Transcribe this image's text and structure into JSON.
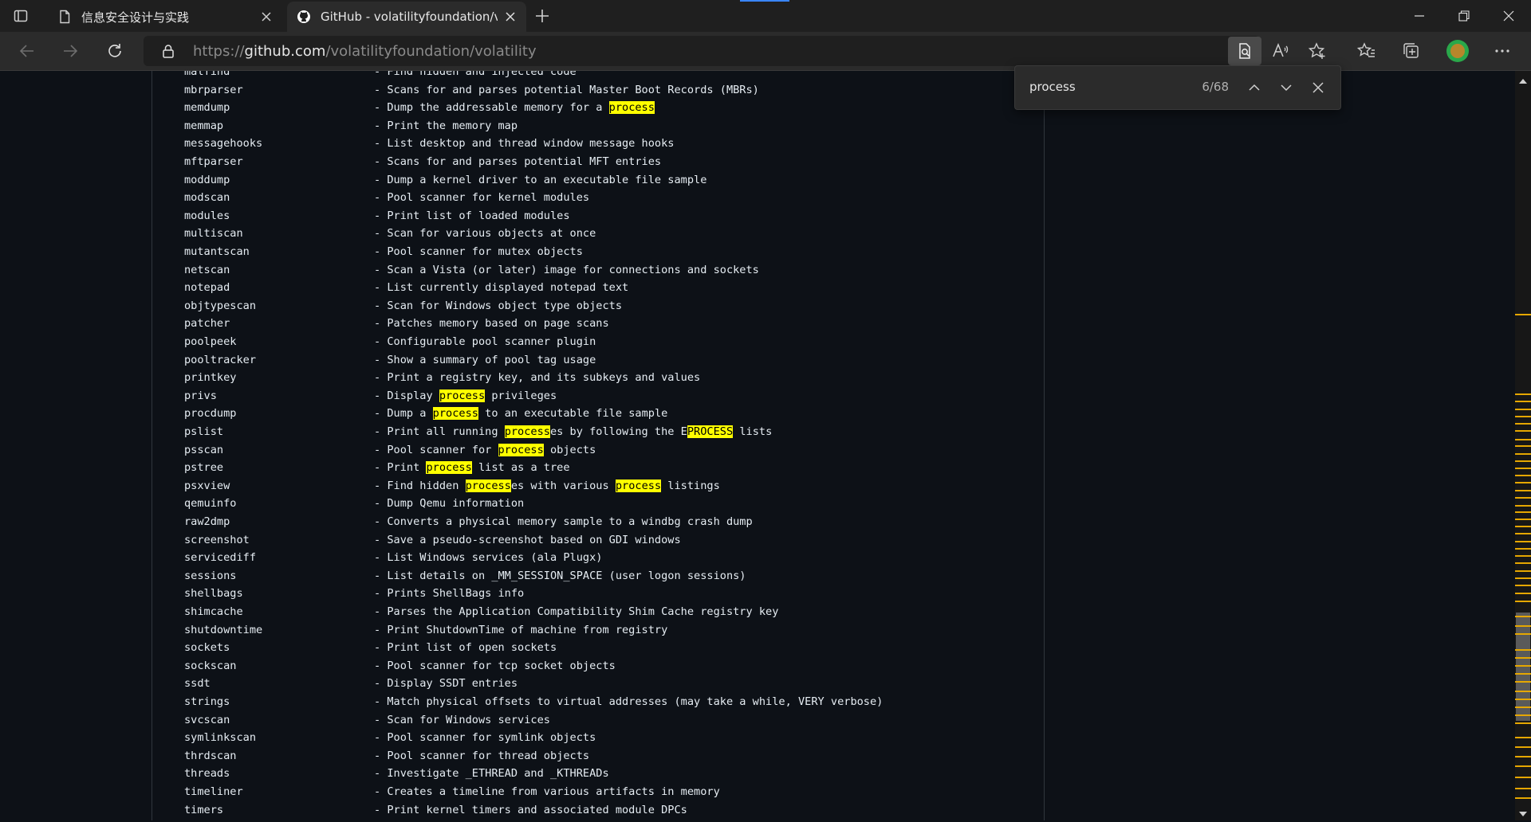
{
  "tabs": [
    {
      "title": "信息安全设计与实践"
    },
    {
      "title": "GitHub - volatilityfoundation/volatility"
    }
  ],
  "address": {
    "scheme": "https://",
    "host": "github.com",
    "path": "/volatilityfoundation/volatility"
  },
  "find": {
    "query": "process",
    "count": "6/68"
  },
  "commands": [
    {
      "name": "malfind",
      "desc": "- Find hidden and injected code"
    },
    {
      "name": "mbrparser",
      "desc": "- Scans for and parses potential Master Boot Records (MBRs)"
    },
    {
      "name": "memdump",
      "desc": "- Dump the addressable memory for a process"
    },
    {
      "name": "memmap",
      "desc": "- Print the memory map"
    },
    {
      "name": "messagehooks",
      "desc": "- List desktop and thread window message hooks"
    },
    {
      "name": "mftparser",
      "desc": "- Scans for and parses potential MFT entries"
    },
    {
      "name": "moddump",
      "desc": "- Dump a kernel driver to an executable file sample"
    },
    {
      "name": "modscan",
      "desc": "- Pool scanner for kernel modules"
    },
    {
      "name": "modules",
      "desc": "- Print list of loaded modules"
    },
    {
      "name": "multiscan",
      "desc": "- Scan for various objects at once"
    },
    {
      "name": "mutantscan",
      "desc": "- Pool scanner for mutex objects"
    },
    {
      "name": "netscan",
      "desc": "- Scan a Vista (or later) image for connections and sockets"
    },
    {
      "name": "notepad",
      "desc": "- List currently displayed notepad text"
    },
    {
      "name": "objtypescan",
      "desc": "- Scan for Windows object type objects"
    },
    {
      "name": "patcher",
      "desc": "- Patches memory based on page scans"
    },
    {
      "name": "poolpeek",
      "desc": "- Configurable pool scanner plugin"
    },
    {
      "name": "pooltracker",
      "desc": "- Show a summary of pool tag usage"
    },
    {
      "name": "printkey",
      "desc": "- Print a registry key, and its subkeys and values"
    },
    {
      "name": "privs",
      "desc": "- Display process privileges"
    },
    {
      "name": "procdump",
      "desc": "- Dump a process to an executable file sample"
    },
    {
      "name": "pslist",
      "desc": "- Print all running processes by following the EPROCESS lists"
    },
    {
      "name": "psscan",
      "desc": "- Pool scanner for process objects"
    },
    {
      "name": "pstree",
      "desc": "- Print process list as a tree"
    },
    {
      "name": "psxview",
      "desc": "- Find hidden processes with various process listings"
    },
    {
      "name": "qemuinfo",
      "desc": "- Dump Qemu information"
    },
    {
      "name": "raw2dmp",
      "desc": "- Converts a physical memory sample to a windbg crash dump"
    },
    {
      "name": "screenshot",
      "desc": "- Save a pseudo-screenshot based on GDI windows"
    },
    {
      "name": "servicediff",
      "desc": "- List Windows services (ala Plugx)"
    },
    {
      "name": "sessions",
      "desc": "- List details on _MM_SESSION_SPACE (user logon sessions)"
    },
    {
      "name": "shellbags",
      "desc": "- Prints ShellBags info"
    },
    {
      "name": "shimcache",
      "desc": "- Parses the Application Compatibility Shim Cache registry key"
    },
    {
      "name": "shutdowntime",
      "desc": "- Print ShutdownTime of machine from registry"
    },
    {
      "name": "sockets",
      "desc": "- Print list of open sockets"
    },
    {
      "name": "sockscan",
      "desc": "- Pool scanner for tcp socket objects"
    },
    {
      "name": "ssdt",
      "desc": "- Display SSDT entries"
    },
    {
      "name": "strings",
      "desc": "- Match physical offsets to virtual addresses (may take a while, VERY verbose)"
    },
    {
      "name": "svcscan",
      "desc": "- Scan for Windows services"
    },
    {
      "name": "symlinkscan",
      "desc": "- Pool scanner for symlink objects"
    },
    {
      "name": "thrdscan",
      "desc": "- Pool scanner for thread objects"
    },
    {
      "name": "threads",
      "desc": "- Investigate _ETHREAD and _KTHREADs"
    },
    {
      "name": "timeliner",
      "desc": "- Creates a timeline from various artifacts in memory"
    },
    {
      "name": "timers",
      "desc": "- Print kernel timers and associated module DPCs"
    }
  ],
  "colors": {
    "highlight": "#ffff00",
    "page_bg": "#0d1117",
    "scroll_marker": "#e6a700"
  }
}
